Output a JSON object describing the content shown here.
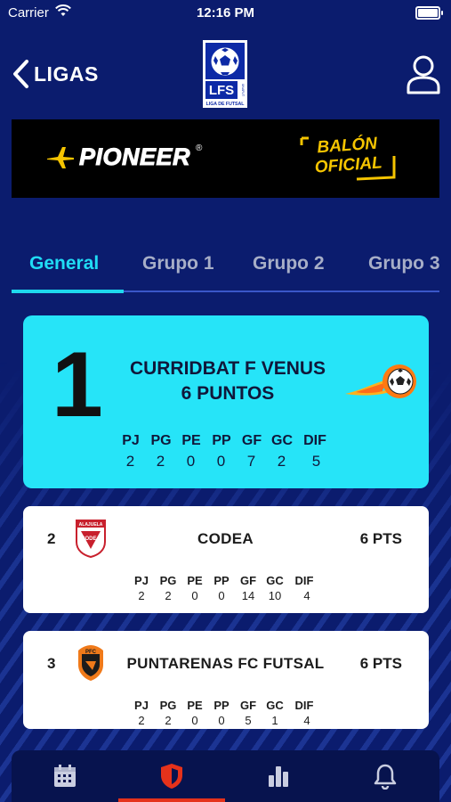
{
  "status_bar": {
    "carrier": "Carrier",
    "time": "12:16 PM"
  },
  "header": {
    "back_label": "LIGAS",
    "logo": {
      "main": "LFS",
      "sub": "LIGA DE FUTSAL",
      "badge": "UNAFUT"
    }
  },
  "banner": {
    "brand": "PIONEER",
    "registered": "®",
    "tagline_line1": "BALÓN",
    "tagline_line2": "OFICIAL"
  },
  "tabs": [
    {
      "label": "General",
      "active": true
    },
    {
      "label": "Grupo 1",
      "active": false
    },
    {
      "label": "Grupo 2",
      "active": false
    },
    {
      "label": "Grupo 3",
      "active": false
    }
  ],
  "stat_headers": [
    "PJ",
    "PG",
    "PE",
    "PP",
    "GF",
    "GC",
    "DIF"
  ],
  "leader": {
    "position": "1",
    "team": "CURRIDBAT F VENUS",
    "points": "6 PUNTOS",
    "stats": [
      "2",
      "2",
      "0",
      "0",
      "7",
      "2",
      "5"
    ]
  },
  "standings": [
    {
      "position": "2",
      "team": "CODEA",
      "points": "6 PTS",
      "stats": [
        "2",
        "2",
        "0",
        "0",
        "14",
        "10",
        "4"
      ],
      "crest_text": "ALAJUELA",
      "crest_sub": "CODEA"
    },
    {
      "position": "3",
      "team": "PUNTARENAS FC FUTSAL",
      "points": "6 PTS",
      "stats": [
        "2",
        "2",
        "0",
        "0",
        "5",
        "1",
        "4"
      ],
      "crest_text": "PFC"
    }
  ],
  "bottom_nav": [
    {
      "icon": "calendar-icon",
      "active": false
    },
    {
      "icon": "shield-icon",
      "active": true
    },
    {
      "icon": "bar-chart-icon",
      "active": false
    },
    {
      "icon": "bell-icon",
      "active": false
    }
  ],
  "colors": {
    "background": "#0b1c6e",
    "accent_cyan": "#26e4f8",
    "active_red": "#e5321b",
    "balon_yellow": "#f5c400"
  }
}
